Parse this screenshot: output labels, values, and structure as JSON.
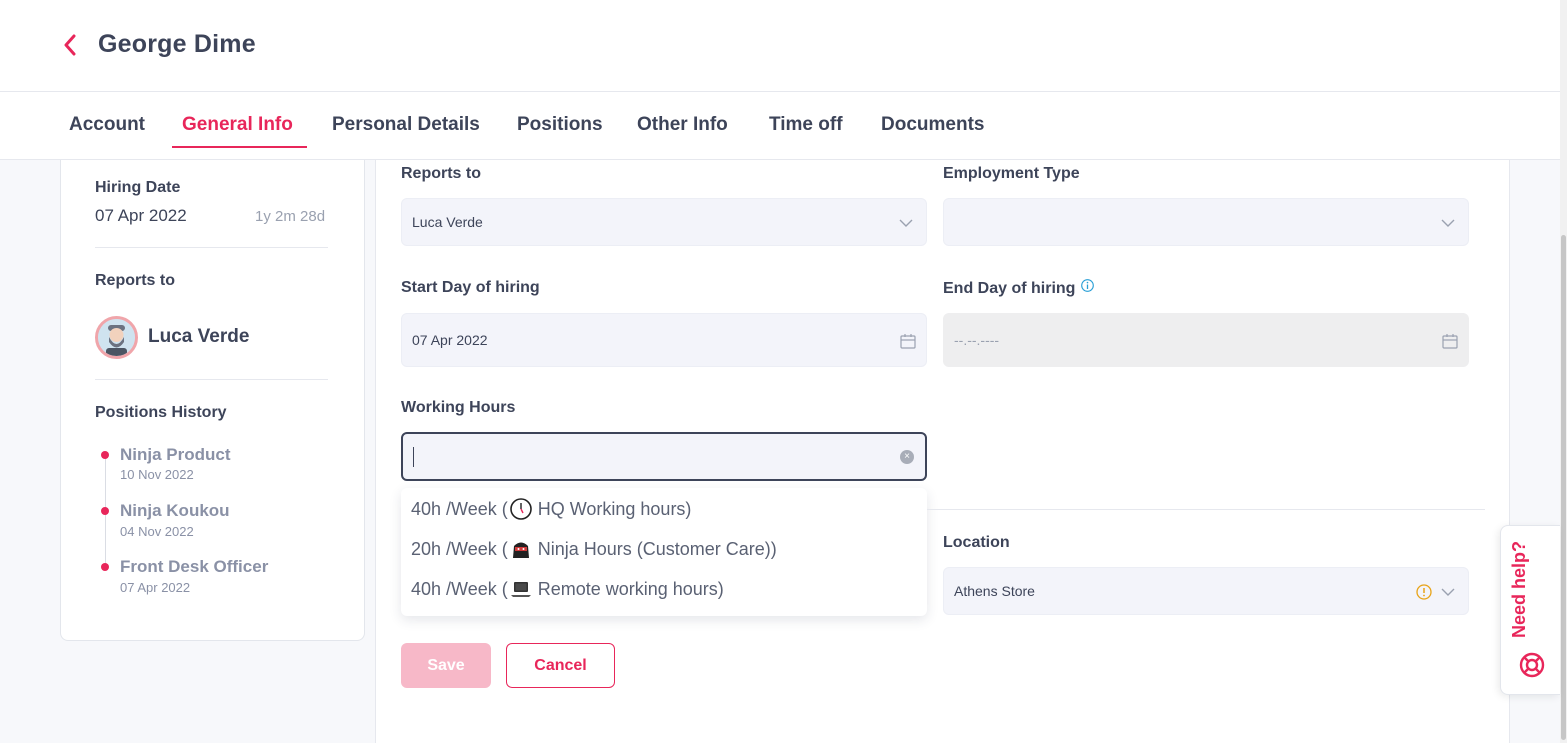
{
  "header": {
    "title": "George Dime"
  },
  "tabs": [
    {
      "label": "Account"
    },
    {
      "label": "General Info"
    },
    {
      "label": "Personal Details"
    },
    {
      "label": "Positions"
    },
    {
      "label": "Other Info"
    },
    {
      "label": "Time off"
    },
    {
      "label": "Documents"
    }
  ],
  "active_tab": "General Info",
  "sidebar": {
    "hiring_date_label": "Hiring Date",
    "hiring_date": "07 Apr 2022",
    "tenure": "1y 2m 28d",
    "reports_to_label": "Reports to",
    "manager_name": "Luca Verde",
    "positions_history_label": "Positions History",
    "positions": [
      {
        "title": "Ninja Product",
        "date": "10 Nov 2022"
      },
      {
        "title": "Ninja Koukou",
        "date": "04 Nov 2022"
      },
      {
        "title": "Front Desk Officer",
        "date": "07 Apr 2022"
      }
    ]
  },
  "form": {
    "reports_to": {
      "label": "Reports to",
      "value": "Luca Verde"
    },
    "employment_type": {
      "label": "Employment Type",
      "value": ""
    },
    "start_day": {
      "label": "Start Day of hiring",
      "value": "07 Apr 2022"
    },
    "end_day": {
      "label": "End Day of hiring",
      "placeholder": "--.--.----"
    },
    "working_hours": {
      "label": "Working Hours",
      "value": "",
      "options": [
        {
          "prefix": "40h /Week (",
          "icon": "clock-icon",
          "text": "HQ Working hours)"
        },
        {
          "prefix": "20h /Week (",
          "icon": "ninja-icon",
          "text": "Ninja Hours (Customer Care))"
        },
        {
          "prefix": "40h /Week (",
          "icon": "laptop-icon",
          "text": "Remote working hours)"
        }
      ]
    },
    "location": {
      "label": "Location",
      "value": "Athens Store"
    },
    "save_label": "Save",
    "cancel_label": "Cancel"
  },
  "help": {
    "label": "Need help?"
  },
  "colors": {
    "accent": "#e8265a",
    "text": "#3d4459",
    "muted": "#8a91a6"
  }
}
